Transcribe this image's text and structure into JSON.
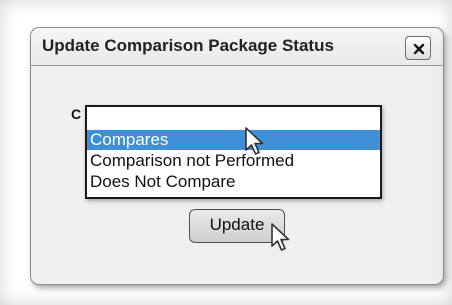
{
  "dialog": {
    "title": "Update Comparison Package Status",
    "close_icon": "close-x-icon",
    "field_label_partial": "C",
    "dropdown": {
      "options": [
        {
          "label": "Compares",
          "selected": true
        },
        {
          "label": "Comparison not Performed",
          "selected": false
        },
        {
          "label": "Does Not Compare",
          "selected": false
        }
      ],
      "highlight_color": "#3e8fd6"
    },
    "update_label": "Update"
  },
  "cursors": [
    "arrow-cursor-icon",
    "arrow-cursor-icon"
  ]
}
